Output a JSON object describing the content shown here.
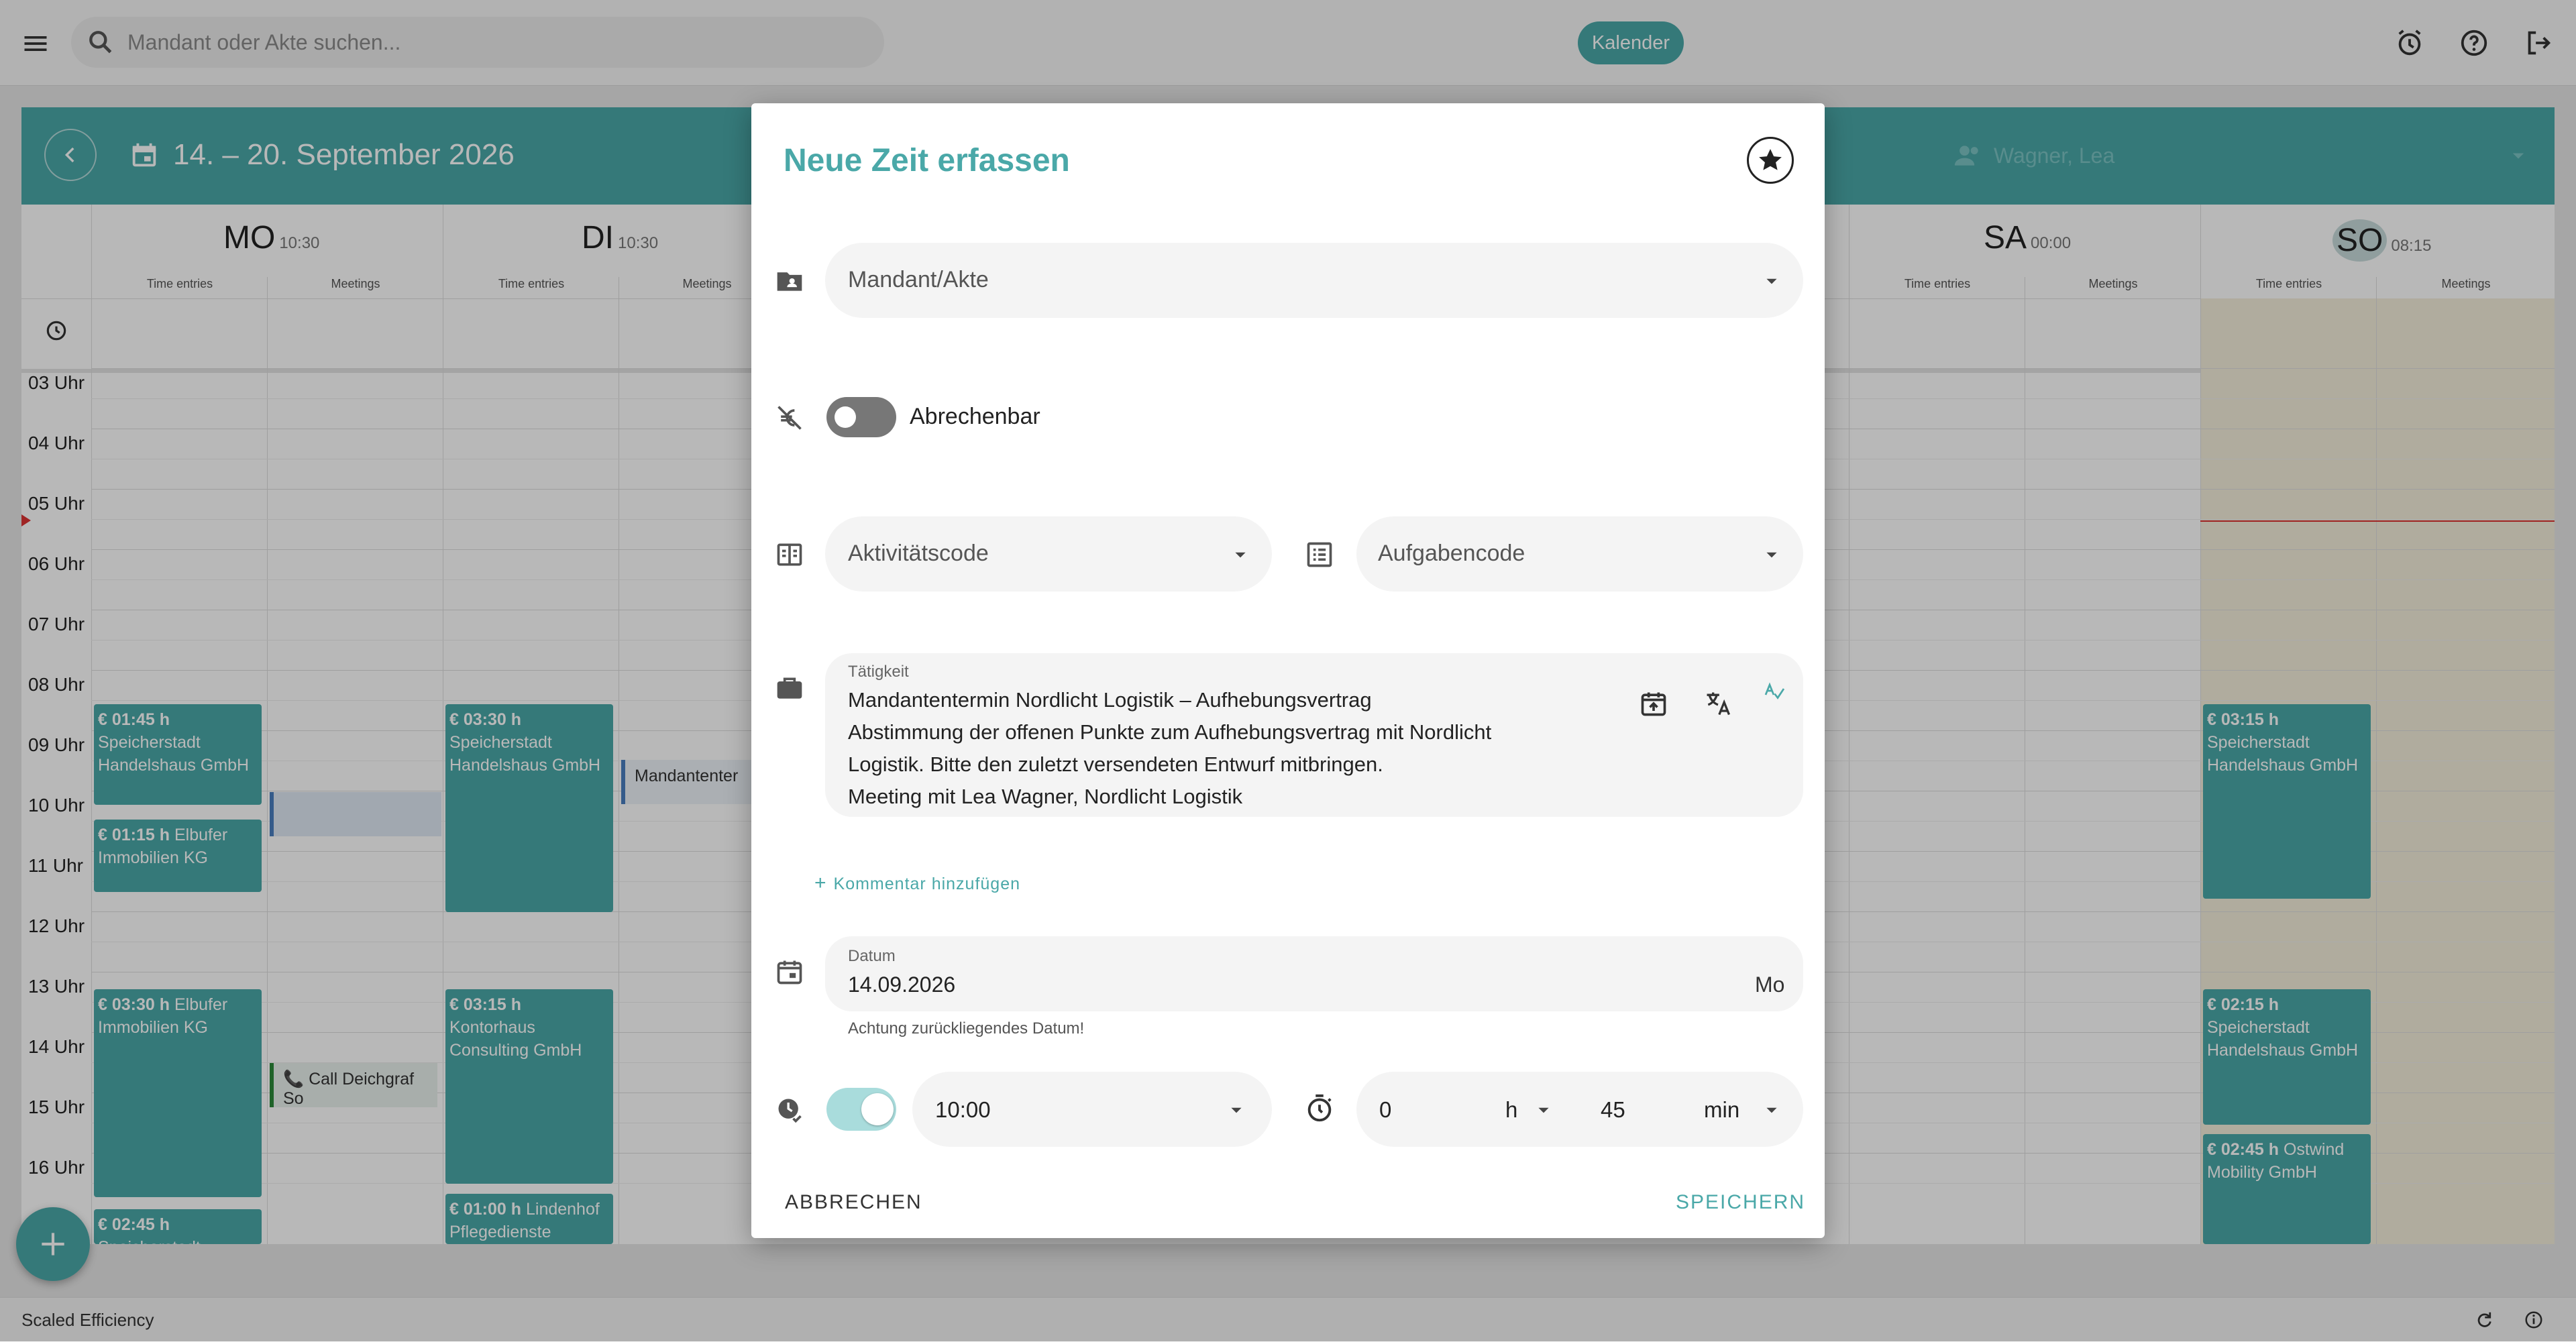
{
  "topbar": {
    "search_placeholder": "Mandant oder Akte suchen...",
    "calendar_pill": "Kalender",
    "icons": [
      "menu-icon",
      "search-icon",
      "alarm-icon",
      "help-icon",
      "logout-icon"
    ]
  },
  "calendar": {
    "range": "14. – 20. September 2026",
    "user": "Wagner, Lea",
    "days": [
      {
        "name": "MO",
        "time": "10:30"
      },
      {
        "name": "DI",
        "time": "10:30"
      },
      {
        "name": "SA",
        "time": "00:00"
      },
      {
        "name": "SO",
        "time": "08:15"
      }
    ],
    "subcols": [
      "Time entries",
      "Meetings"
    ],
    "hours": [
      "03 Uhr",
      "04 Uhr",
      "05 Uhr",
      "06 Uhr",
      "07 Uhr",
      "08 Uhr",
      "09 Uhr",
      "10 Uhr",
      "11 Uhr",
      "12 Uhr",
      "13 Uhr",
      "14 Uhr",
      "15 Uhr",
      "16 Uhr"
    ],
    "events": [
      {
        "dur": "01:45 h",
        "text": "Speicherstadt Handelshaus GmbH"
      },
      {
        "dur": "01:15 h",
        "text": "Elbufer Immobilien KG"
      },
      {
        "dur": "03:30 h",
        "text": "Elbufer Immobilien KG"
      },
      {
        "dur": "02:45 h",
        "text": "Speicherstadt Handelshaus"
      },
      {
        "dur": "03:30 h",
        "text": "Speicherstadt Handelshaus GmbH"
      },
      {
        "dur": "03:15 h",
        "text": "Kontorhaus Consulting GmbH"
      },
      {
        "dur": "01:00 h",
        "text": "Lindenhof Pflegedienste gGmbH"
      },
      {
        "dur": "03:15 h",
        "text": "Speicherstadt Handelshaus GmbH"
      },
      {
        "dur": "02:15 h",
        "text": "Speicherstadt Handelshaus GmbH"
      },
      {
        "dur": "02:45 h",
        "text": "Ostwind Mobility GmbH"
      }
    ],
    "meetings": [
      {
        "text": "Call Deichgraf So"
      },
      {
        "text": "Mandantenter"
      }
    ]
  },
  "dialog": {
    "title": "Neue Zeit erfassen",
    "mandant_label": "Mandant/Akte",
    "billable_label": "Abrechenbar",
    "billable_on": false,
    "activity_label": "Aktivitätscode",
    "task_label": "Aufgabencode",
    "taetigkeit_label": "Tätigkeit",
    "taetigkeit_lines": [
      "Mandantentermin Nordlicht Logistik – Aufhebungsvertrag",
      "Abstimmung der offenen Punkte zum Aufhebungsvertrag mit Nordlicht",
      "Logistik. Bitte den zuletzt versendeten Entwurf mitbringen.",
      "Meeting mit Lea Wagner, Nordlicht Logistik"
    ],
    "comment_link": "Kommentar hinzufügen",
    "date_label": "Datum",
    "date_value": "14.09.2026",
    "date_weekday": "Mo",
    "date_warning": "Achtung zurückliegendes Datum!",
    "start_toggle_on": true,
    "start_time": "10:00",
    "duration_h": "0",
    "h_unit": "h",
    "duration_min": "45",
    "min_unit": "min",
    "cancel": "ABBRECHEN",
    "save": "SPEICHERN"
  },
  "footer": {
    "brand": "Scaled Efficiency"
  },
  "colors": {
    "accent": "#4aa8a8",
    "accent_light": "#a9dcdc"
  }
}
